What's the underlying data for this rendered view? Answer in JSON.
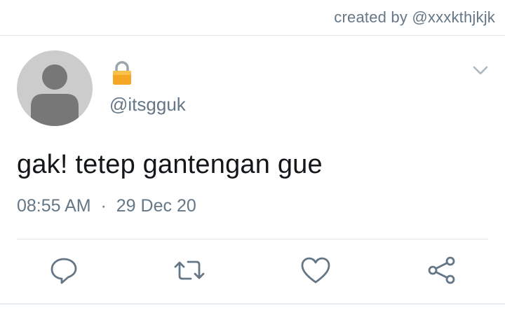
{
  "watermark": {
    "text": "created by @xxxkthjkjk"
  },
  "tweet": {
    "handle": "@itsgguk",
    "text": "gak! tetep gantengan gue",
    "time": "08:55 AM",
    "separator": "·",
    "date": "29 Dec 20"
  },
  "icons": {
    "avatar": "default-profile-avatar",
    "lock": "lock-icon",
    "menu": "chevron-down-icon",
    "reply": "reply-icon",
    "retweet": "retweet-icon",
    "like": "heart-icon",
    "share": "share-icon"
  },
  "colors": {
    "text": "#14171a",
    "secondary": "#657786",
    "icon": "#657786",
    "divider": "#e1e8ed",
    "avatar_bg": "#cccccc",
    "avatar_fg": "#777777",
    "lock": "#f5a623"
  }
}
